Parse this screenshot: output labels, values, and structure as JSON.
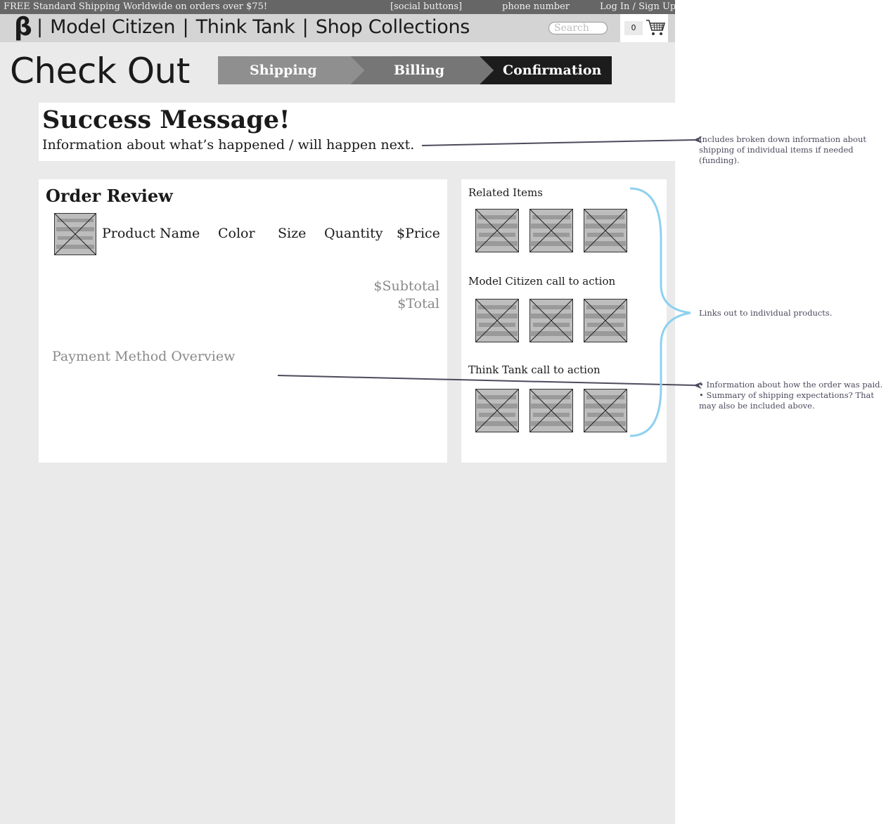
{
  "topbar": {
    "promo": "FREE Standard Shipping Worldwide on orders over $75!",
    "social": "[social buttons]",
    "phone": "phone number",
    "login": "Log In / Sign Up"
  },
  "nav": {
    "logo": "β",
    "separator": "|",
    "links": [
      "Model Citizen",
      "Think Tank",
      "Shop Collections"
    ],
    "search_placeholder": "Search",
    "cart_count": "0"
  },
  "checkout": {
    "title": "Check Out",
    "steps": [
      "Shipping",
      "Billing",
      "Confirmation"
    ],
    "active_step": "Confirmation"
  },
  "success": {
    "title": "Success Message!",
    "info": "Information about what’s happened / will happen next."
  },
  "order_review": {
    "title": "Order Review",
    "columns": [
      "Product Name",
      "Color",
      "Size",
      "Quantity",
      "$Price"
    ],
    "subtotal": "$Subtotal",
    "total": "$Total",
    "payment": "Payment Method Overview"
  },
  "side": {
    "sections": [
      {
        "heading": "Related Items"
      },
      {
        "heading": "Model Citizen call to action"
      },
      {
        "heading": "Think Tank call to action"
      }
    ]
  },
  "annotations": {
    "shipping_note": "Includes broken down information about shipping of individual items if needed (funding).",
    "links_note": "Links out to individual products.",
    "payment_note_1": "• Information about how the order was paid.",
    "payment_note_2": "• Summary of shipping expectations? That may also be included above."
  },
  "colors": {
    "page_bg": "#eaeaea",
    "topbar": "#666666",
    "navbar": "#d4d4d4",
    "step_1": "#8f8f8f",
    "step_2": "#767676",
    "step_active": "#1c1c1c",
    "annotation_arrow": "#4e4a5e",
    "brace": "#8ed1f0"
  }
}
